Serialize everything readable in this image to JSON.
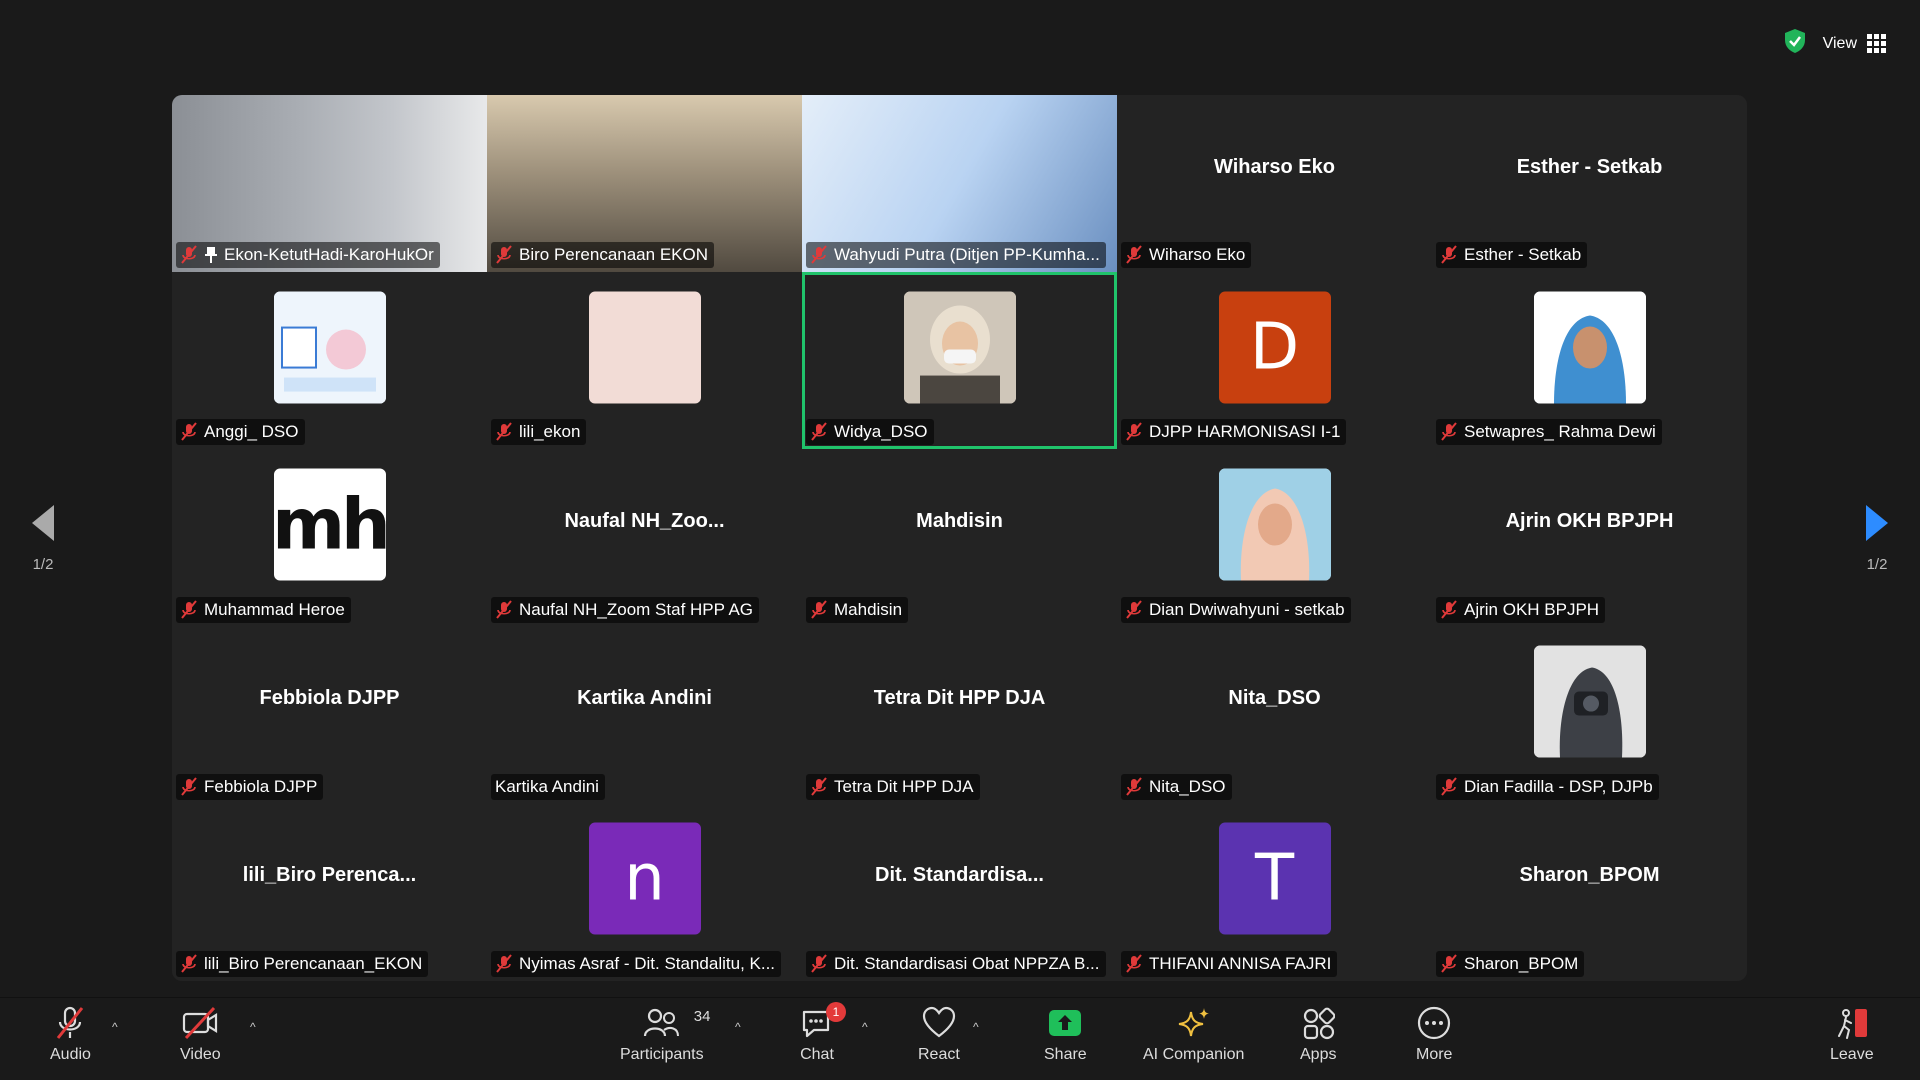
{
  "top": {
    "view_label": "View"
  },
  "pager": {
    "left_label": "1/2",
    "right_label": "1/2"
  },
  "tiles": [
    {
      "label": "Ekon-KetutHadi-KaroHukOr"
    },
    {
      "label": "Biro Perencanaan EKON"
    },
    {
      "label": "Wahyudi Putra (Ditjen PP-Kumha..."
    },
    {
      "center": "Wiharso Eko",
      "label": "Wiharso Eko"
    },
    {
      "center": "Esther - Setkab",
      "label": "Esther - Setkab"
    },
    {
      "label": "Anggi_ DSO"
    },
    {
      "label": "lili_ekon"
    },
    {
      "label": "Widya_DSO"
    },
    {
      "avatar_letter": "D",
      "label": "DJPP HARMONISASI I-1"
    },
    {
      "label": "Setwapres_ Rahma Dewi"
    },
    {
      "avatar_letter": "mh",
      "label": "Muhammad Heroe"
    },
    {
      "center": "Naufal  NH_Zoo...",
      "label": "Naufal NH_Zoom Staf HPP AG"
    },
    {
      "center": "Mahdisin",
      "label": "Mahdisin"
    },
    {
      "label": "Dian Dwiwahyuni - setkab"
    },
    {
      "center": "Ajrin OKH BPJPH",
      "label": "Ajrin OKH BPJPH"
    },
    {
      "center": "Febbiola DJPP",
      "label": "Febbiola DJPP"
    },
    {
      "center": "Kartika Andini",
      "label": "Kartika Andini"
    },
    {
      "center": "Tetra Dit HPP DJA",
      "label": "Tetra Dit HPP DJA"
    },
    {
      "center": "Nita_DSO",
      "label": "Nita_DSO"
    },
    {
      "label": "Dian Fadilla - DSP, DJPb"
    },
    {
      "center": "lili_Biro  Perenca...",
      "label": "lili_Biro Perencanaan_EKON"
    },
    {
      "avatar_letter": "n",
      "label": "Nyimas Asraf - Dit. Standalitu, K..."
    },
    {
      "center": "Dit.  Standardisa...",
      "label": "Dit. Standardisasi Obat NPPZA B..."
    },
    {
      "avatar_letter": "T",
      "label": "THIFANI ANNISA FAJRI"
    },
    {
      "center": "Sharon_BPOM",
      "label": "Sharon_BPOM"
    }
  ],
  "colors": {
    "active_border": "#20c36b",
    "muted_mic": "#e03a3a",
    "avatar_d": "#c8400f",
    "avatar_purple": "#7a2ab8",
    "avatar_t": "#5b33b0",
    "share_green": "#1fbf5a",
    "leave_red": "#e03a3a"
  },
  "toolbar": {
    "audio": "Audio",
    "video": "Video",
    "participants": "Participants",
    "participants_count": "34",
    "chat": "Chat",
    "chat_badge": "1",
    "react": "React",
    "share": "Share",
    "ai_companion": "AI Companion",
    "apps": "Apps",
    "more": "More",
    "leave": "Leave"
  }
}
